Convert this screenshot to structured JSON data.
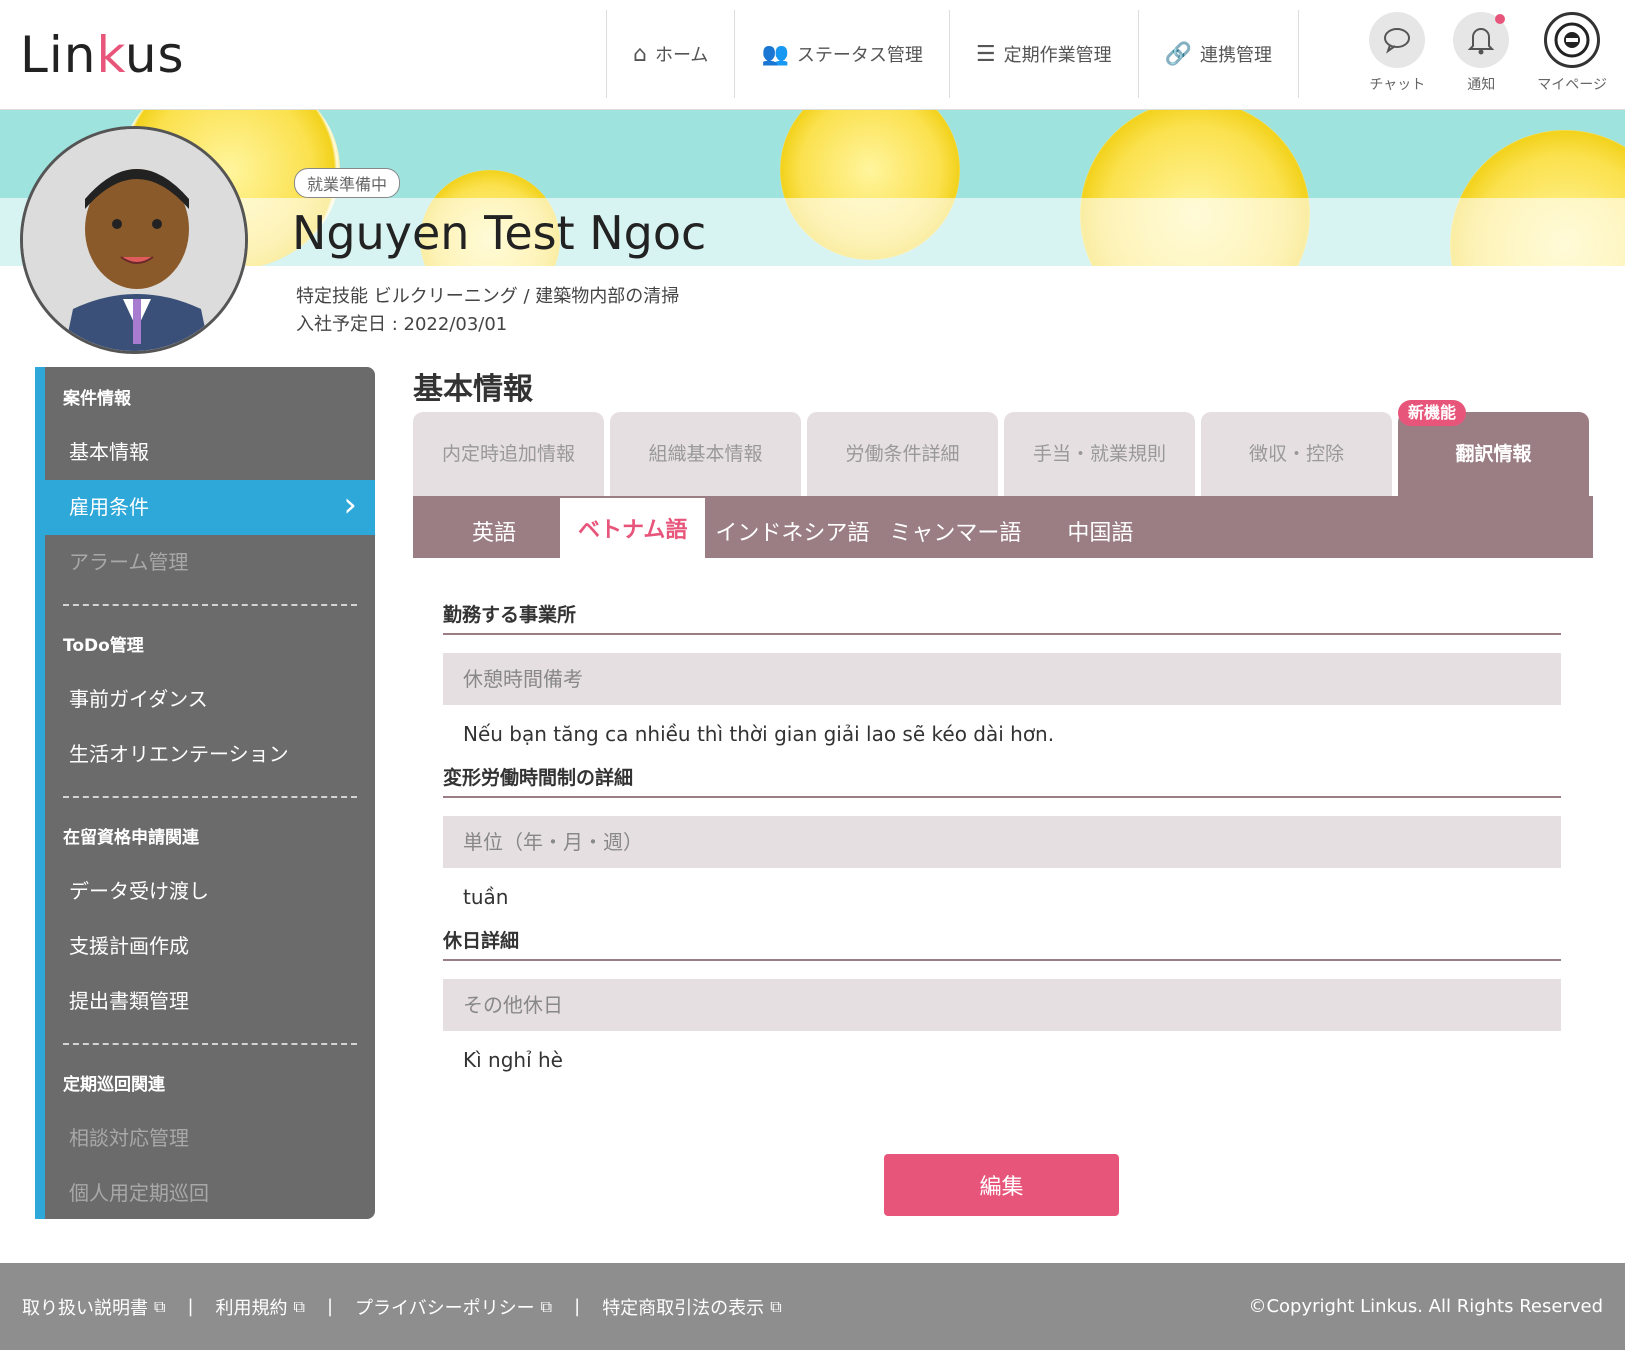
{
  "header": {
    "logo": "Linkus",
    "nav": [
      {
        "label": "ホーム",
        "icon": "home-icon"
      },
      {
        "label": "ステータス管理",
        "icon": "users-icon"
      },
      {
        "label": "定期作業管理",
        "icon": "checklist-icon"
      },
      {
        "label": "連携管理",
        "icon": "link-icon"
      }
    ],
    "chat_label": "チャット",
    "notify_label": "通知",
    "mypage_label": "マイページ"
  },
  "profile": {
    "status": "就業準備中",
    "name": "Nguyen Test Ngoc",
    "job": "特定技能 ビルクリーニング / 建築物内部の清掃",
    "start_date": "入社予定日 : 2022/03/01"
  },
  "sidebar": {
    "sections": [
      {
        "title": "案件情報",
        "items": [
          {
            "label": "基本情報",
            "state": "normal"
          },
          {
            "label": "雇用条件",
            "state": "active"
          },
          {
            "label": "アラーム管理",
            "state": "disabled"
          }
        ]
      },
      {
        "title": "ToDo管理",
        "items": [
          {
            "label": "事前ガイダンス",
            "state": "normal"
          },
          {
            "label": "生活オリエンテーション",
            "state": "normal"
          }
        ]
      },
      {
        "title": "在留資格申請関連",
        "items": [
          {
            "label": "データ受け渡し",
            "state": "normal"
          },
          {
            "label": "支援計画作成",
            "state": "normal"
          },
          {
            "label": "提出書類管理",
            "state": "normal"
          }
        ]
      },
      {
        "title": "定期巡回関連",
        "items": [
          {
            "label": "相談対応管理",
            "state": "disabled"
          },
          {
            "label": "個人用定期巡回",
            "state": "disabled"
          }
        ]
      }
    ]
  },
  "main": {
    "title": "基本情報",
    "tabs": [
      "内定時追加情報",
      "組織基本情報",
      "労働条件詳細",
      "手当・就業規則",
      "徴収・控除",
      "翻訳情報"
    ],
    "new_badge": "新機能",
    "languages": [
      "英語",
      "ベトナム語",
      "インドネシア語",
      "ミャンマー語",
      "中国語"
    ],
    "sections": [
      {
        "title": "勤務する事業所",
        "label": "休憩時間備考",
        "value": "Nếu bạn tăng ca nhiều thì thời gian giải lao sẽ kéo dài hơn."
      },
      {
        "title": "変形労働時間制の詳細",
        "label": "単位（年・月・週）",
        "value": "tuần"
      },
      {
        "title": "休日詳細",
        "label": "その他休日",
        "value": "Kì nghỉ hè"
      }
    ],
    "edit_label": "編集"
  },
  "footer": {
    "links": [
      "取り扱い説明書",
      "利用規約",
      "プライバシーポリシー",
      "特定商取引法の表示"
    ],
    "copyright": "©Copyright Linkus. All Rights Reserved"
  },
  "colors": {
    "accent": "#e8557a",
    "sidebar": "#6b6b6b",
    "active": "#2ea7d9",
    "tab": "#9a7e84"
  }
}
